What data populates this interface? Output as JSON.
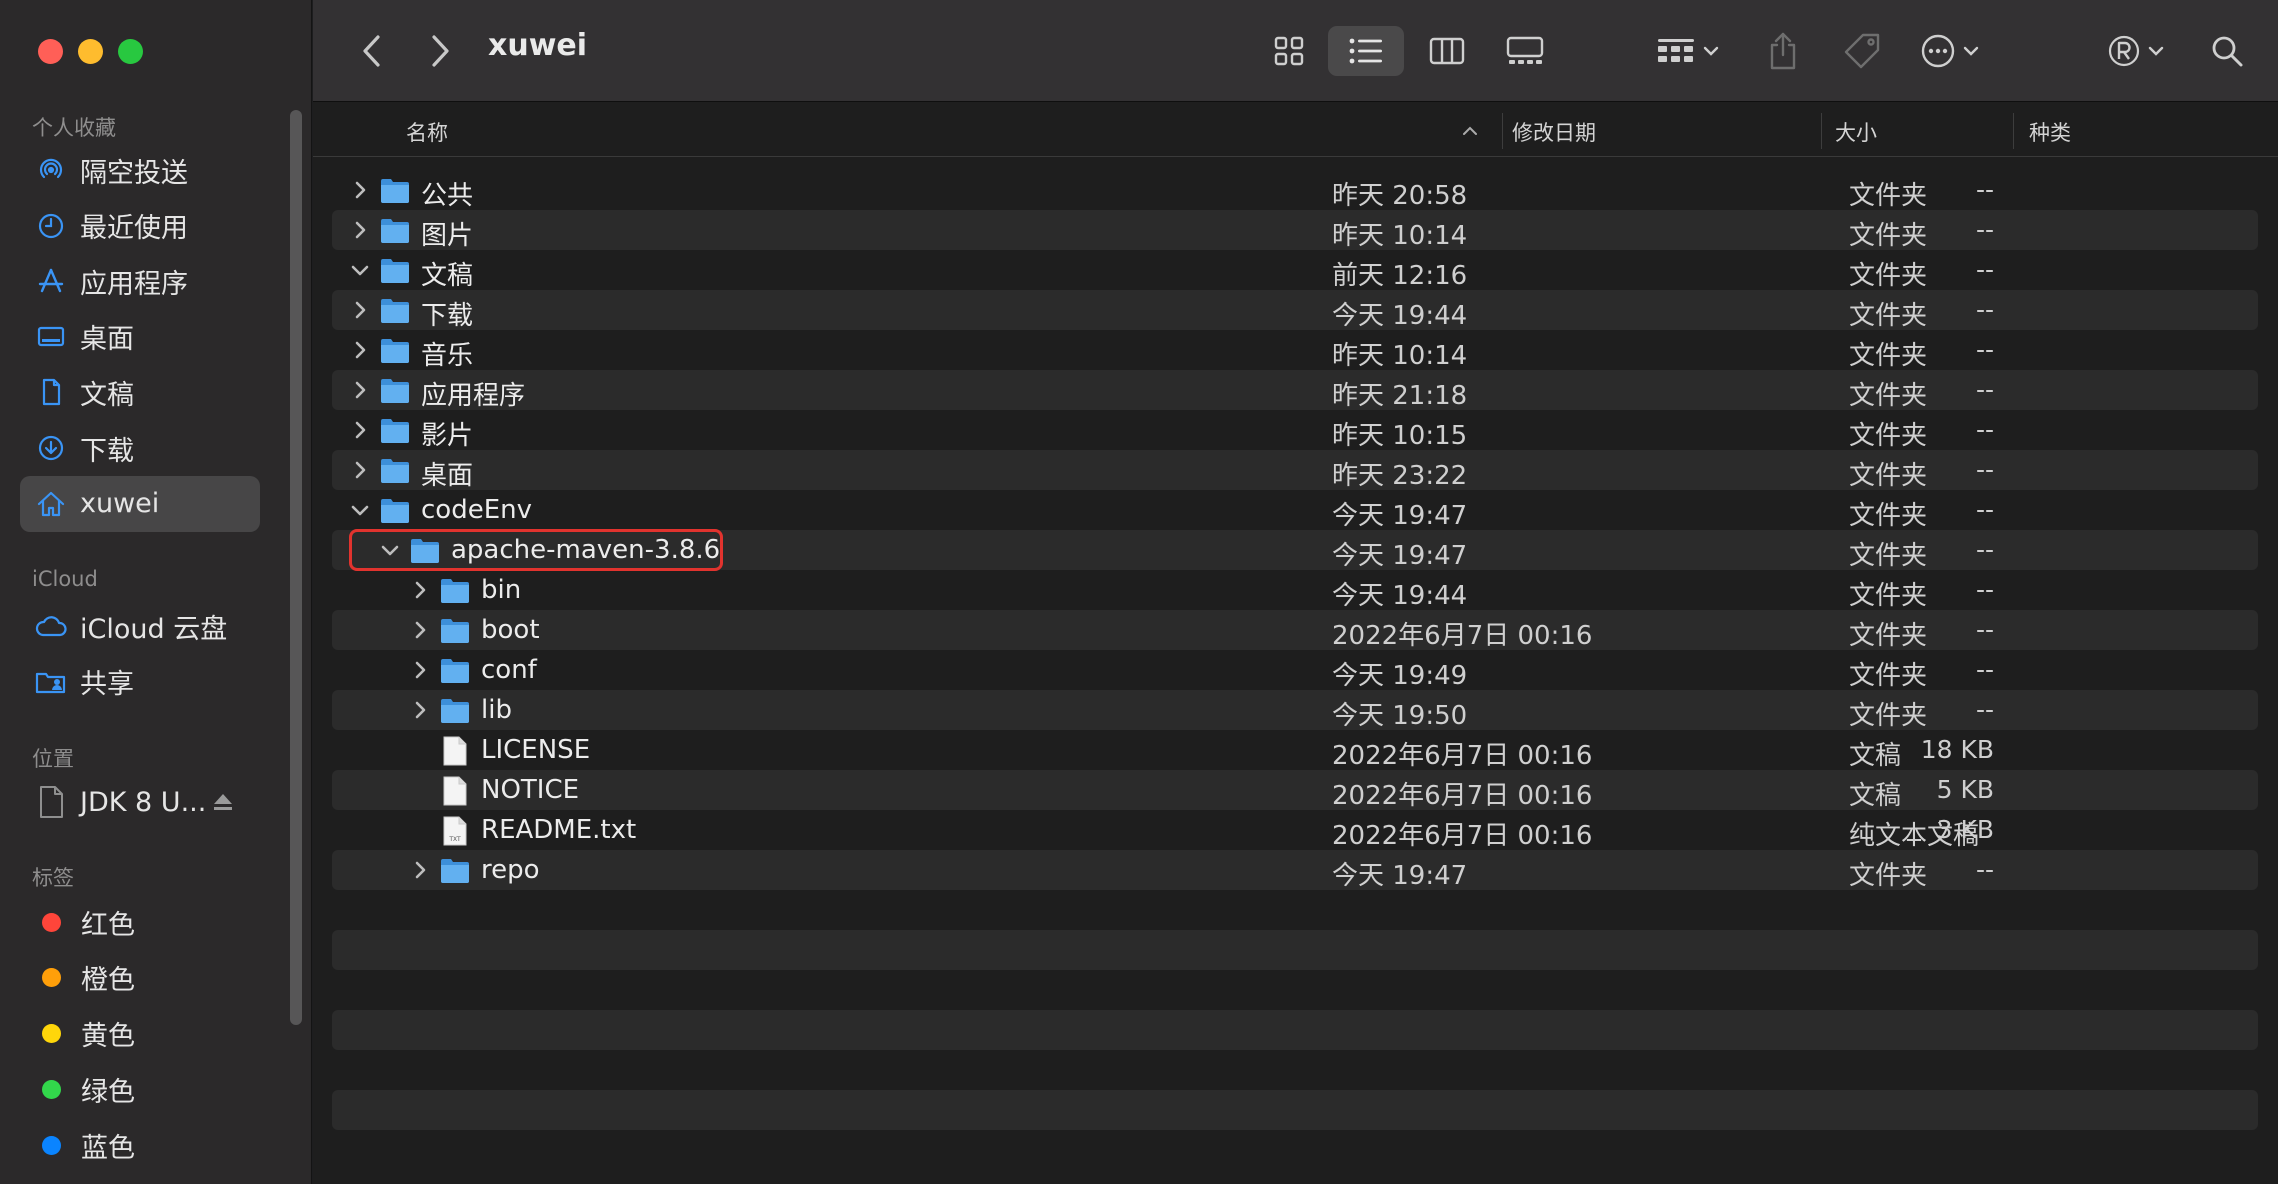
{
  "window": {
    "title": "xuwei"
  },
  "sidebar": {
    "favorites_header": "个人收藏",
    "favorites": [
      {
        "label": "隔空投送",
        "icon": "airdrop-icon"
      },
      {
        "label": "最近使用",
        "icon": "clock-icon"
      },
      {
        "label": "应用程序",
        "icon": "applications-icon"
      },
      {
        "label": "桌面",
        "icon": "desktop-icon"
      },
      {
        "label": "文稿",
        "icon": "document-icon"
      },
      {
        "label": "下载",
        "icon": "download-icon"
      },
      {
        "label": "xuwei",
        "icon": "home-icon",
        "selected": true
      }
    ],
    "icloud_header": "iCloud",
    "icloud": [
      {
        "label": "iCloud 云盘",
        "icon": "cloud-icon"
      },
      {
        "label": "共享",
        "icon": "shared-folder-icon"
      }
    ],
    "locations_header": "位置",
    "locations": [
      {
        "label": "JDK 8 U...",
        "icon": "disk-image-icon",
        "eject": "eject-icon"
      }
    ],
    "tags_header": "标签",
    "tags": [
      {
        "label": "红色",
        "color": "#ff453a"
      },
      {
        "label": "橙色",
        "color": "#ff9f0a"
      },
      {
        "label": "黄色",
        "color": "#ffd60a"
      },
      {
        "label": "绿色",
        "color": "#32d74b"
      },
      {
        "label": "蓝色",
        "color": "#0a84ff"
      }
    ]
  },
  "toolbar": {
    "icons": [
      "back-icon",
      "forward-icon",
      "icon-view-icon",
      "list-view-icon",
      "column-view-icon",
      "gallery-view-icon",
      "group-icon",
      "share-icon",
      "tag-icon",
      "more-icon",
      "registered-icon",
      "search-icon"
    ],
    "selected_view": "list"
  },
  "columns": {
    "name": "名称",
    "date": "修改日期",
    "size": "大小",
    "kind": "种类"
  },
  "files": [
    {
      "name": "公共",
      "date": "昨天 20:58",
      "size": "--",
      "kind": "文件夹",
      "level": 0,
      "expanded": false,
      "type": "folder"
    },
    {
      "name": "图片",
      "date": "昨天 10:14",
      "size": "--",
      "kind": "文件夹",
      "level": 0,
      "expanded": false,
      "type": "folder"
    },
    {
      "name": "文稿",
      "date": "前天 12:16",
      "size": "--",
      "kind": "文件夹",
      "level": 0,
      "expanded": true,
      "type": "folder"
    },
    {
      "name": "下载",
      "date": "今天 19:44",
      "size": "--",
      "kind": "文件夹",
      "level": 0,
      "expanded": false,
      "type": "folder"
    },
    {
      "name": "音乐",
      "date": "昨天 10:14",
      "size": "--",
      "kind": "文件夹",
      "level": 0,
      "expanded": false,
      "type": "folder"
    },
    {
      "name": "应用程序",
      "date": "昨天 21:18",
      "size": "--",
      "kind": "文件夹",
      "level": 0,
      "expanded": false,
      "type": "folder"
    },
    {
      "name": "影片",
      "date": "昨天 10:15",
      "size": "--",
      "kind": "文件夹",
      "level": 0,
      "expanded": false,
      "type": "folder"
    },
    {
      "name": "桌面",
      "date": "昨天 23:22",
      "size": "--",
      "kind": "文件夹",
      "level": 0,
      "expanded": false,
      "type": "folder"
    },
    {
      "name": "codeEnv",
      "date": "今天 19:47",
      "size": "--",
      "kind": "文件夹",
      "level": 0,
      "expanded": true,
      "type": "folder"
    },
    {
      "name": "apache-maven-3.8.6",
      "date": "今天 19:47",
      "size": "--",
      "kind": "文件夹",
      "level": 1,
      "expanded": true,
      "type": "folder",
      "highlighted": true
    },
    {
      "name": "bin",
      "date": "今天 19:44",
      "size": "--",
      "kind": "文件夹",
      "level": 2,
      "expanded": false,
      "type": "folder"
    },
    {
      "name": "boot",
      "date": "2022年6月7日 00:16",
      "size": "--",
      "kind": "文件夹",
      "level": 2,
      "expanded": false,
      "type": "folder"
    },
    {
      "name": "conf",
      "date": "今天 19:49",
      "size": "--",
      "kind": "文件夹",
      "level": 2,
      "expanded": false,
      "type": "folder"
    },
    {
      "name": "lib",
      "date": "今天 19:50",
      "size": "--",
      "kind": "文件夹",
      "level": 2,
      "expanded": false,
      "type": "folder"
    },
    {
      "name": "LICENSE",
      "date": "2022年6月7日 00:16",
      "size": "18 KB",
      "kind": "文稿",
      "level": 2,
      "type": "file"
    },
    {
      "name": "NOTICE",
      "date": "2022年6月7日 00:16",
      "size": "5 KB",
      "kind": "文稿",
      "level": 2,
      "type": "file"
    },
    {
      "name": "README.txt",
      "date": "2022年6月7日 00:16",
      "size": "3 KB",
      "kind": "纯文本文稿",
      "level": 2,
      "type": "txt"
    },
    {
      "name": "repo",
      "date": "今天 19:47",
      "size": "--",
      "kind": "文件夹",
      "level": 2,
      "expanded": false,
      "type": "folder"
    }
  ]
}
